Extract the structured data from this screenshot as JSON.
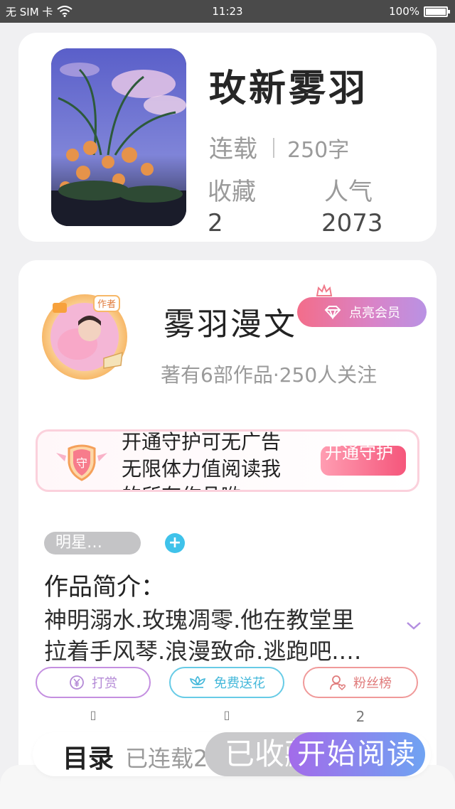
{
  "status_bar": {
    "carrier": "无 SIM 卡",
    "time": "11:23",
    "battery": "100%"
  },
  "book": {
    "title": "玫新雾羽",
    "serial_label": "连载",
    "word_count": "250字",
    "favorites_label": "收藏",
    "popularity_label": "人气",
    "favorites_value": "2",
    "popularity_value": "2073"
  },
  "author": {
    "badge": "作者",
    "name": "雾羽漫文",
    "vip_button": "点亮会员",
    "meta": "著有6部作品·250人关注"
  },
  "guard_banner": {
    "badge": "守",
    "lines": [
      "开通守护可无广告",
      "无限体力值阅读我",
      "的所有作品哟~"
    ],
    "button": "开通守护"
  },
  "tags": {
    "tag1": "明星…",
    "add": "+"
  },
  "intro": {
    "label": "作品简介：",
    "line1": "神明溺水.玫瑰凋零.他在教堂里",
    "line2": "拉着手风琴.浪漫致命.逃跑吧.…"
  },
  "actions": [
    {
      "label": "打赏",
      "count": "▯"
    },
    {
      "label": "免费送花",
      "count": "▯"
    },
    {
      "label": "粉丝榜",
      "count": "2"
    }
  ],
  "bottom_nav": {
    "catalog": "目录",
    "serialized": "已连载2",
    "favorited": "已收藏",
    "start_reading": "开始阅读"
  },
  "colors": {
    "accent_pink": "#f36d8a",
    "accent_purple": "#a36bea",
    "accent_blue": "#3fc2ea"
  }
}
